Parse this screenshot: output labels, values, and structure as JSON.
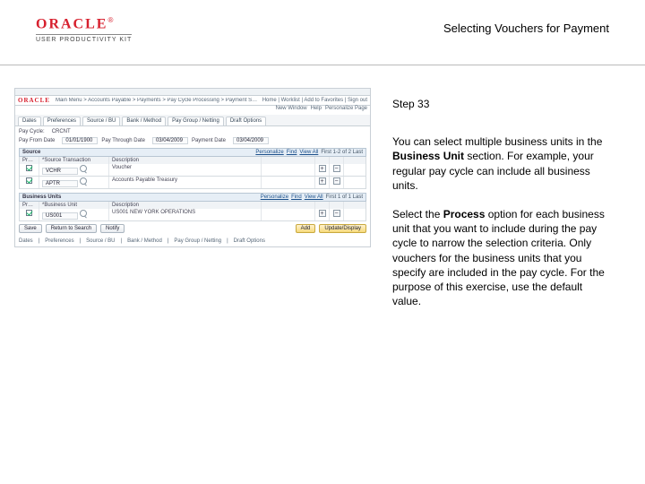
{
  "header": {
    "brand": "ORACLE",
    "sub": "USER PRODUCTIVITY KIT",
    "title": "Selecting Vouchers for Payment"
  },
  "instruction": {
    "step": "Step 33",
    "p1_a": "You can select multiple business units in the ",
    "p1_b": "Business Unit",
    "p1_c": " section. For example, your regular pay cycle can include all business units.",
    "p2_a": "Select the ",
    "p2_b": "Process",
    "p2_c": " option for each business unit that you want to include during the pay cycle to narrow the selection criteria. Only vouchers for the business units that you specify are included in the pay cycle. For the purpose of this exercise, use the default value."
  },
  "app": {
    "crumbs": "Main Menu > Accounts Payable > Payments > Pay Cycle Processing > Payment Selection Criteria",
    "toplinks": "Home | Worklist | Add to Favorites | Sign out",
    "subnav": [
      "New Window",
      "Help",
      "Personalize Page"
    ],
    "tabs": [
      "Dates",
      "Preferences",
      "Source / BU",
      "Bank / Method",
      "Pay Group / Netting",
      "Draft Options"
    ],
    "paycycle_lbl": "Pay Cycle:",
    "paycycle_val": "CRCNT",
    "from_lbl": "Pay From Date",
    "from_val": "01/01/1900",
    "thru_lbl": "Pay Through Date",
    "thru_val": "03/04/2009",
    "pdate_lbl": "Payment Date",
    "pdate_val": "03/04/2009",
    "grid1": {
      "title": "Source",
      "personalize": "Personalize",
      "find": "Find",
      "viewall": "View All",
      "range": "First 1-2 of 2 Last",
      "cols": [
        "Process",
        "*Source Transaction",
        "Description"
      ],
      "rows": [
        {
          "chk": true,
          "a": "VCHR",
          "b": "Voucher"
        },
        {
          "chk": true,
          "a": "APTR",
          "b": "Accounts Payable Treasury"
        }
      ]
    },
    "grid2": {
      "title": "Business Units",
      "personalize": "Personalize",
      "find": "Find",
      "viewall": "View All",
      "range": "First 1 of 1 Last",
      "cols": [
        "Process",
        "*Business Unit",
        "Description"
      ],
      "rows": [
        {
          "chk": true,
          "a": "US001",
          "b": "US001 NEW YORK OPERATIONS"
        }
      ]
    },
    "buttons": {
      "save": "Save",
      "return": "Return to Search",
      "notify": "Notify",
      "add": "Add",
      "update": "Update/Display"
    },
    "footer": [
      "Dates",
      "Preferences",
      "Source / BU",
      "Bank / Method",
      "Pay Group / Netting",
      "Draft Options"
    ]
  }
}
